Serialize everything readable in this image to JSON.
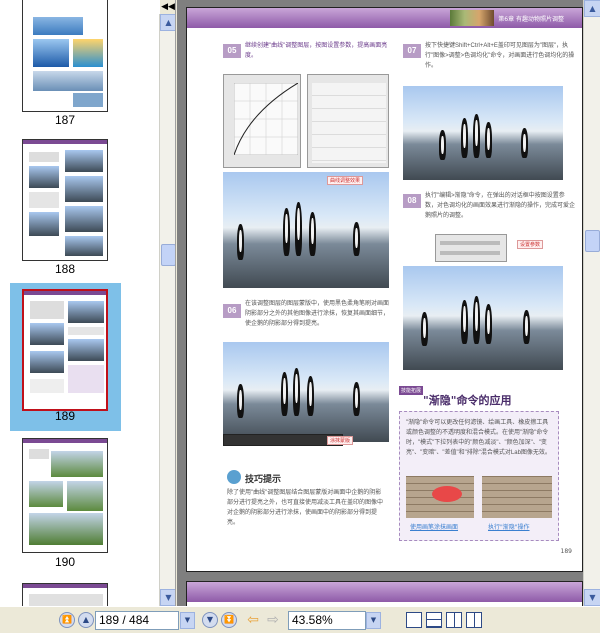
{
  "thumbnails": [
    {
      "label": "187",
      "selected": false
    },
    {
      "label": "188",
      "selected": false
    },
    {
      "label": "189",
      "selected": true
    },
    {
      "label": "190",
      "selected": false
    }
  ],
  "page": {
    "chapter_header": "第6章 有趣动物照片调整",
    "steps": [
      {
        "num": "05",
        "text": "继续创建\"曲线\"调整图层，按图设置参数，提高画面亮度。"
      },
      {
        "num": "07",
        "text": "按下快捷键Shift+Ctrl+Alt+E盖印可见图层为\"图层\"，执行\"图像>调整>色调均化\"命令，对画面进行色调均化的操作。"
      },
      {
        "num": "06",
        "text": "在该调整图层的图层蒙版中，使用黑色柔角笔刷对画面阴影部分之外的其他图像进行涂抹，恢复其画面细节，使企鹅的阴影部分得到提亮。"
      },
      {
        "num": "08",
        "text": "执行\"编辑>渐隐\"命令，在弹出的对话框中按图设置参数，对色调均化的画面效果进行渐隐的操作，完成可爱企鹅照片的调整。"
      }
    ],
    "labels": {
      "curves_effect": "曲线调整效果",
      "fade_settings": "设置参数",
      "mask_label": "涂抹蒙版"
    },
    "tip": {
      "title": "技巧提示",
      "text": "除了使用\"曲线\"调整图层结合图层蒙版对画面中企鹅的阴影部分进行提亮之外，也可直接使用减淡工具在盖印的图像中对企鹅的阴影部分进行涂抹，使画面中的阴影部分得到提亮。"
    },
    "section": {
      "tag": "技能拓展",
      "title": "\"渐隐\"命令的应用",
      "text": "\"渐隐\"命令可以更改任何滤镜、绘画工具、橡皮擦工具或颜色调整的不透明度和混合模式。在使用\"渐隐\"命令时，\"模式\"下拉列表中的\"颜色减淡\"、\"颜色加深\"、\"变亮\"、\"变暗\"、\"差值\"和\"排除\"混合模式对Lab图像无效。",
      "caption_left": "使用画笔涂抹画面",
      "caption_right": "执行\"渐隐\"操作"
    },
    "page_number": "189"
  },
  "toolbar": {
    "page_input": "189 / 484",
    "zoom_input": "43.58%"
  },
  "colors": {
    "header_purple": "#8e5aa8",
    "selection_blue": "#7ec0e8",
    "scroll_blue": "#c7d5f3",
    "nav_arrow_orange": "#e8a23a"
  },
  "icons": {
    "collapse": "double-left-arrow-icon",
    "first_page": "first-page-icon",
    "prev_page": "previous-page-icon",
    "next_page": "next-page-icon",
    "last_page": "last-page-icon",
    "back": "back-arrow-icon",
    "forward": "forward-arrow-icon",
    "views": [
      "single-page-icon",
      "continuous-page-icon",
      "facing-pages-icon",
      "continuous-facing-icon"
    ]
  }
}
